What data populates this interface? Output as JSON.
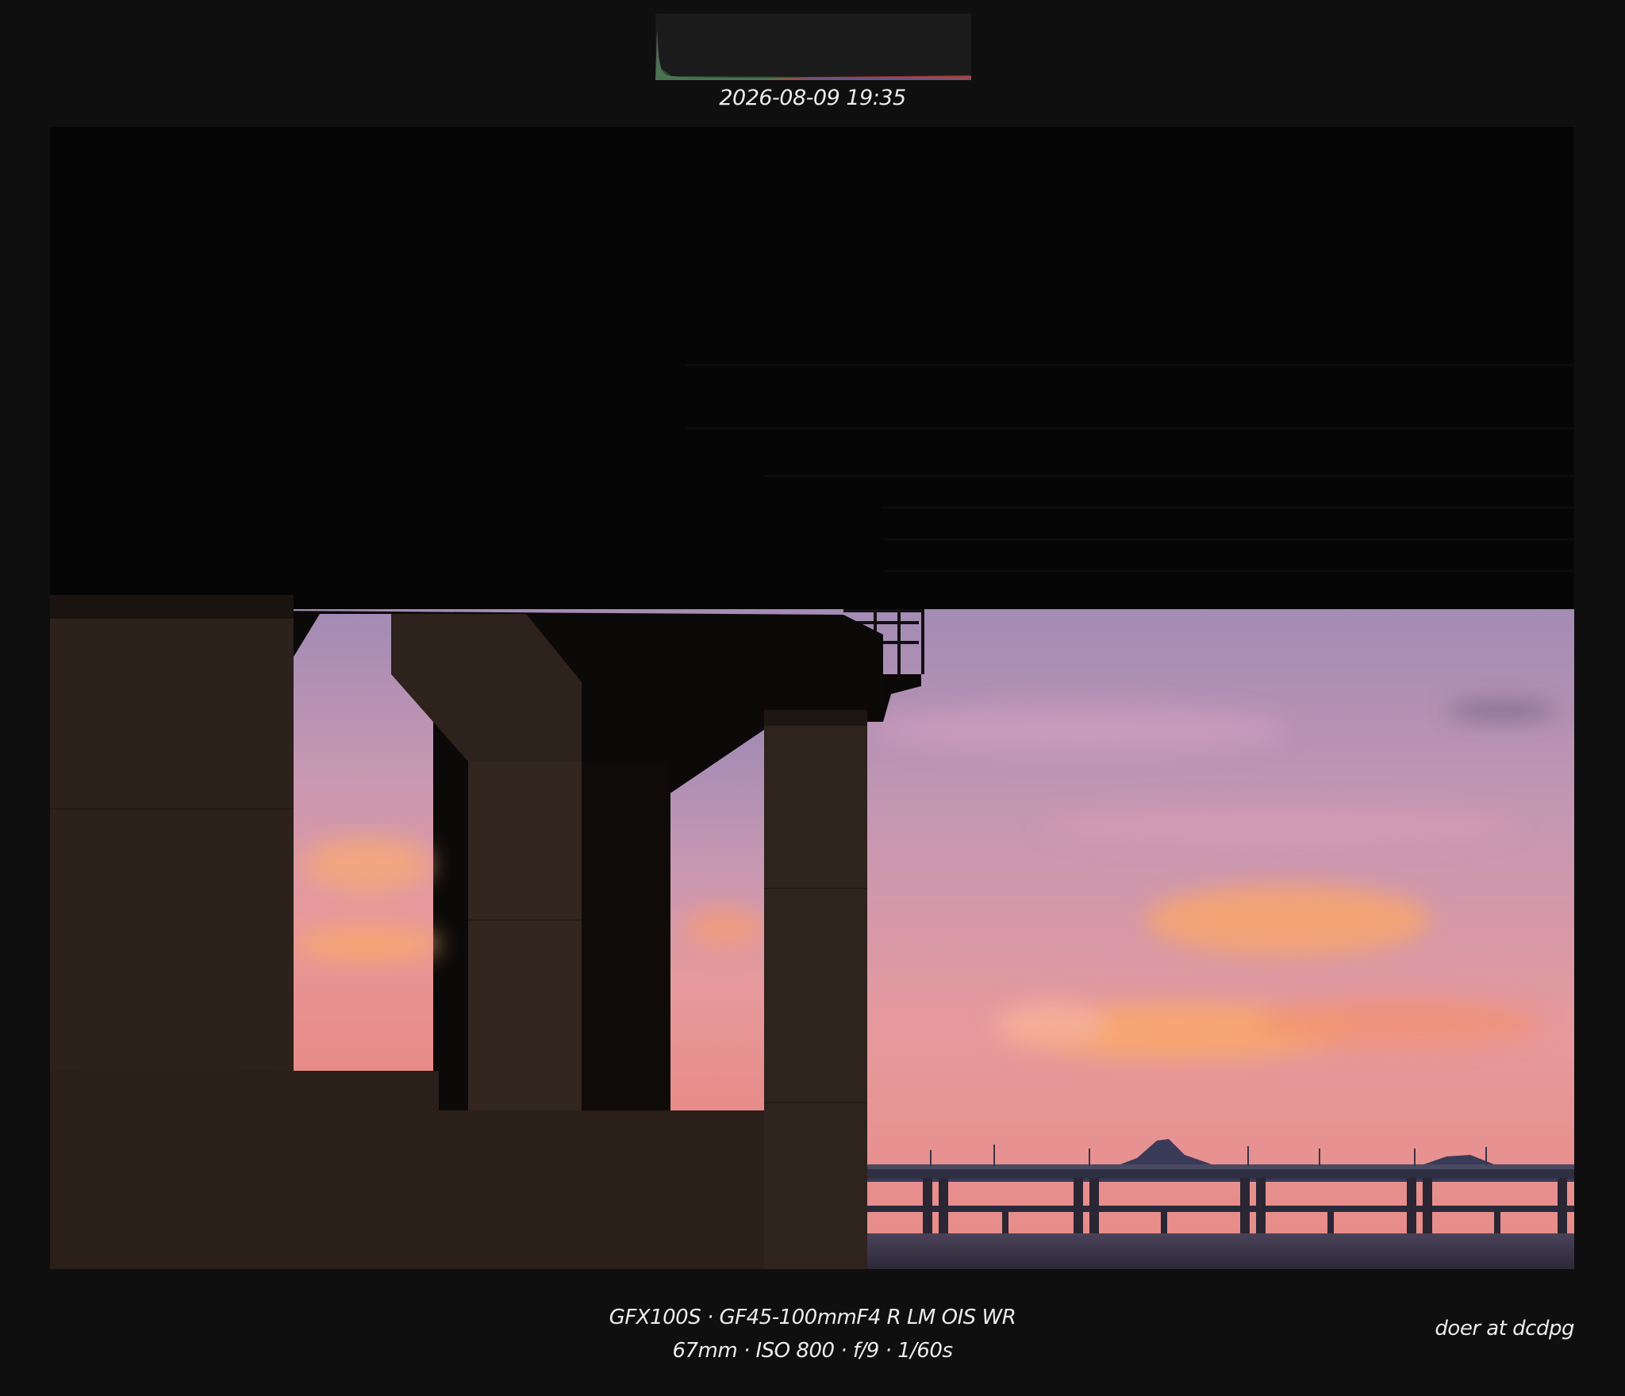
{
  "header": {
    "timestamp": "2026-08-09 19:35"
  },
  "photo": {
    "subject": "Silhouetted concrete bridge pillars framing a pink and orange sunset sky over a river"
  },
  "exif": {
    "camera_lens": "GFX100S · GF45-100mmF4 R LM OIS WR",
    "settings": "67mm · ISO 800 · f/9 · 1/60s"
  },
  "credit": {
    "text": "doer at dcdpg"
  },
  "colors": {
    "background": "#0f0f0f",
    "sky_top": "#a891b8",
    "sky_mid": "#e79a9c",
    "cloud_orange": "#f7a66e",
    "silhouette": "#050505",
    "pillar": "#2a1f1a",
    "text": "#ececec"
  }
}
